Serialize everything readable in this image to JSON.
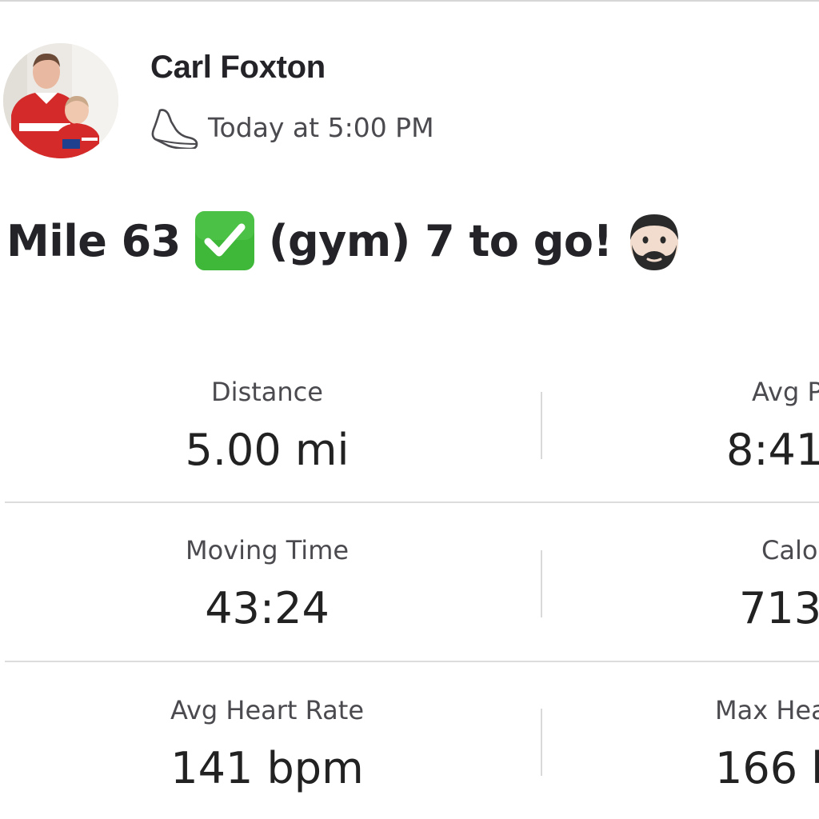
{
  "activity": {
    "athlete_name": "Carl Foxton",
    "timestamp": "Today at 5:00 PM",
    "activity_type_icon": "shoe-icon",
    "title_parts": [
      "Mile 63",
      "(gym) 7 to go!"
    ],
    "title_emojis": [
      "check-mark-button-icon",
      "bearded-face-icon"
    ]
  },
  "stats": {
    "rows": [
      {
        "left": {
          "label": "Distance",
          "value": "5.00 mi"
        },
        "right": {
          "label": "Avg P",
          "value": "8:41"
        }
      },
      {
        "left": {
          "label": "Moving Time",
          "value": "43:24"
        },
        "right": {
          "label": "Calo",
          "value": "713"
        }
      },
      {
        "left": {
          "label": "Avg Heart Rate",
          "value": "141 bpm"
        },
        "right": {
          "label": "Max Hea",
          "value": "166 b"
        }
      }
    ]
  },
  "colors": {
    "text_primary": "#242428",
    "text_secondary": "#4a4a4f",
    "divider": "#dcdcdc",
    "check_green": "#3fb83a",
    "jersey_red": "#d42a2a"
  }
}
